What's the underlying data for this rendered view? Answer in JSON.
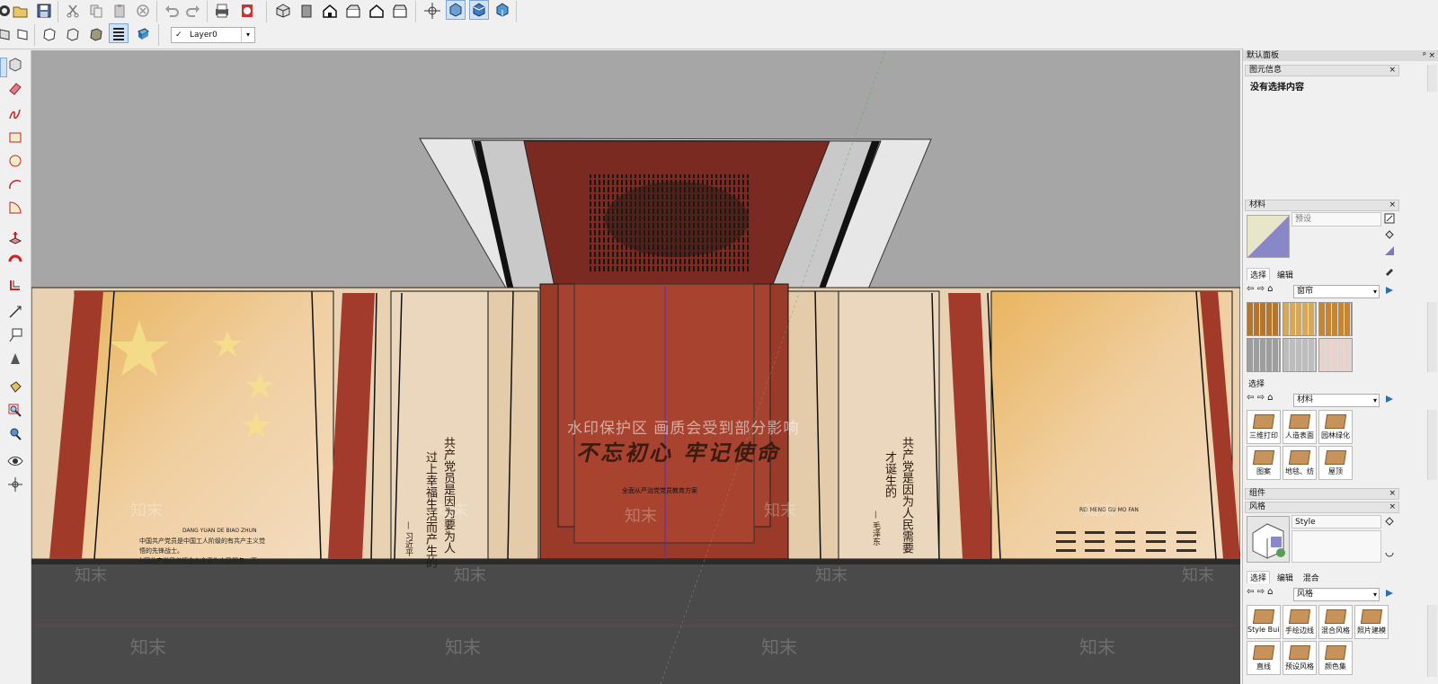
{
  "toolbar": {
    "layer_check": "✓",
    "layer_value": "Layer0",
    "dropdown_arrow": "▾",
    "icons_row1": [
      "sketchup-icon",
      "open-icon",
      "save-icon",
      "cut-icon",
      "copy-icon",
      "paste-icon",
      "erase-icon",
      "undo-icon",
      "redo-icon",
      "print-icon",
      "report-icon",
      "iso-view-icon",
      "top-view-icon",
      "front-view-icon",
      "right-view-icon",
      "back-view-icon",
      "left-view-icon",
      "orbit-icon",
      "xray-style-icon",
      "shaded-style-icon",
      "textured-style-icon"
    ],
    "icons_row2": [
      "wireframe-icon",
      "hidden-line-icon",
      "shaded-icon",
      "monochrome-icon",
      "layers-icon",
      "shadow-icon"
    ]
  },
  "left_tools": [
    "select-icon",
    "make-component-icon",
    "eraser-icon",
    "freehand-icon",
    "rectangle-icon",
    "circle-icon",
    "arc-icon",
    "pie-icon",
    "push-pull-icon",
    "follow-me-icon",
    "offset-icon",
    "tape-measure-icon",
    "text-icon",
    "dimension-icon",
    "paint-bucket-icon",
    "zoom-window-icon",
    "position-camera-icon",
    "look-around-icon",
    "walk-icon"
  ],
  "viewport": {
    "watermark_main": "水印保护区   画质会受到部分影响",
    "watermark_brand": "知末",
    "center_title": "不忘初心  牢记使命",
    "center_subtitle": "全面从严治党党员教育方案",
    "left_panel_caption": "DANG YUAN DE BIAO ZHUN",
    "right_panel_caption": "REI MENG GU MO FAN",
    "left_body_lines": [
      "中国共产党员是中国工人阶级的有共产主义觉",
      "悟的先锋战士。",
      "中国共产党员必须全心全意为人民服务，不"
    ],
    "left_poem_col1": "共产党员是因为要为人",
    "left_poem_col2": "过上幸福生活而产生的",
    "left_poem_sign": "— 习近平",
    "right_poem_col1": "共产党是因为人民需要",
    "right_poem_col2": "才诞生的",
    "right_poem_sign": "— 毛泽东",
    "right_grid_item": "先进者"
  },
  "panel": {
    "tray_title": "默认面板",
    "entity_info": {
      "title": "图元信息",
      "content": "没有选择内容"
    },
    "materials": {
      "title": "材料",
      "name_placeholder": "预设",
      "tabs": [
        "选择",
        "编辑"
      ],
      "collection": "窗帘",
      "swatch_colors": [
        "#b5762c",
        "#d6a95a",
        "#c58633",
        "#9e9e9e",
        "#bdbdbd",
        "#e7d3cb"
      ],
      "lower_label": "选择",
      "lower_collection": "材料",
      "library": [
        "三维打印",
        "人造表面",
        "园林绿化",
        "图案",
        "地毯、纺",
        "屋顶"
      ]
    },
    "components": {
      "title": "组件"
    },
    "styles": {
      "title": "风格",
      "style_name": "Style",
      "tabs": [
        "选择",
        "编辑",
        "混合"
      ],
      "collection": "风格",
      "library": [
        "Style Build",
        "手绘边线",
        "混合风格",
        "照片建模",
        "直线",
        "预设风格",
        "颜色集"
      ]
    }
  }
}
